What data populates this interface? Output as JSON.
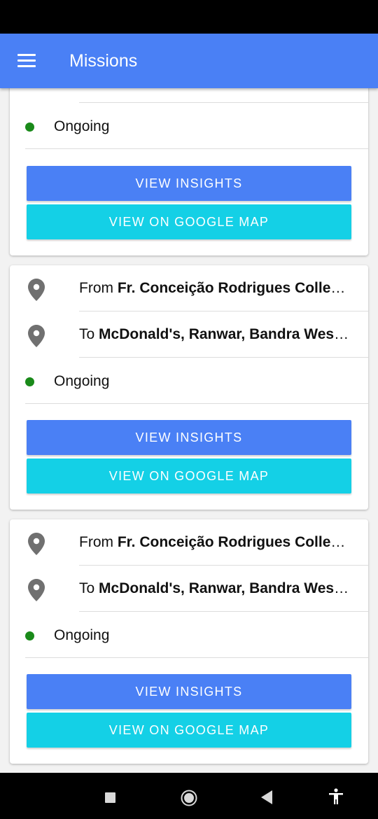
{
  "app_bar": {
    "title": "Missions",
    "menu_icon": "menu-icon",
    "color": "#4a80f5"
  },
  "cards": [
    {
      "status": "Ongoing",
      "insights_label": "VIEW INSIGHTS",
      "map_label": "VIEW ON GOOGLE MAP"
    },
    {
      "from_prefix": "From",
      "from_place": "Fr. Conceição Rodrigues College of Engineering, Bandra West, Mumbai",
      "to_prefix": "To",
      "to_place": "McDonald's, Ranwar, Bandra West, Mumbai",
      "status": "Ongoing",
      "insights_label": "VIEW INSIGHTS",
      "map_label": "VIEW ON GOOGLE MAP"
    },
    {
      "from_prefix": "From",
      "from_place": "Fr. Conceição Rodrigues College of Engineering, Bandra West, Mumbai",
      "to_prefix": "To",
      "to_place": "McDonald's, Ranwar, Bandra West, Mumbai",
      "status": "Ongoing",
      "insights_label": "VIEW INSIGHTS",
      "map_label": "VIEW ON GOOGLE MAP"
    }
  ],
  "colors": {
    "primary": "#4a80f5",
    "accent": "#14d0e6",
    "status_ongoing": "#1a8a1a"
  },
  "nav": {
    "icons": [
      "square-recents-icon",
      "circle-home-icon",
      "triangle-back-icon",
      "accessibility-icon"
    ]
  }
}
